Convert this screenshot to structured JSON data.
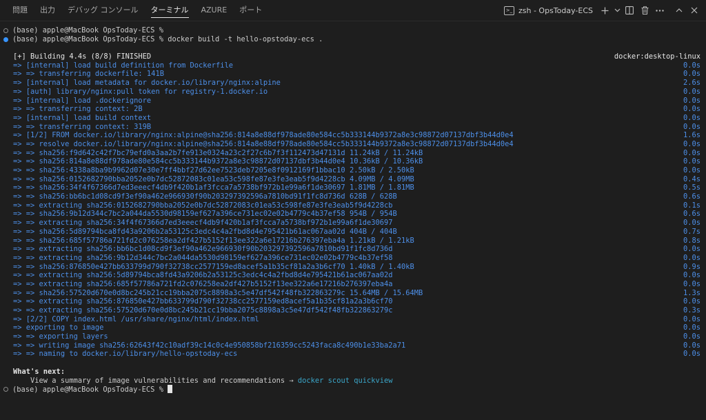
{
  "panel": {
    "tabs": [
      "問題",
      "出力",
      "デバッグ コンソール",
      "ターミナル",
      "AZURE",
      "ポート"
    ],
    "active_tab": "ターミナル",
    "terminal_label": "zsh - OpsToday-ECS"
  },
  "terminal": {
    "prompt1": "(base) apple@MacBook OpsToday-ECS %",
    "prompt2": "(base) apple@MacBook OpsToday-ECS % docker build -t hello-opstoday-ecs .",
    "build_header": "[+] Building 4.4s (8/8) FINISHED",
    "build_context": "docker:desktop-linux",
    "steps": [
      {
        "text": "=> [internal] load build definition from Dockerfile",
        "time": "0.0s"
      },
      {
        "text": "=> => transferring dockerfile: 141B",
        "time": "0.0s"
      },
      {
        "text": "=> [internal] load metadata for docker.io/library/nginx:alpine",
        "time": "2.6s"
      },
      {
        "text": "=> [auth] library/nginx:pull token for registry-1.docker.io",
        "time": "0.0s"
      },
      {
        "text": "=> [internal] load .dockerignore",
        "time": "0.0s"
      },
      {
        "text": "=> => transferring context: 2B",
        "time": "0.0s"
      },
      {
        "text": "=> [internal] load build context",
        "time": "0.0s"
      },
      {
        "text": "=> => transferring context: 319B",
        "time": "0.0s"
      },
      {
        "text": "=> [1/2] FROM docker.io/library/nginx:alpine@sha256:814a8e88df978ade80e584cc5b333144b9372a8e3c98872d07137dbf3b44d0e4",
        "time": "1.6s"
      },
      {
        "text": "=> => resolve docker.io/library/nginx:alpine@sha256:814a8e88df978ade80e584cc5b333144b9372a8e3c98872d07137dbf3b44d0e4",
        "time": "0.0s"
      },
      {
        "text": "=> => sha256:f9d642c42f7bc79efd0a3aa2b7fe913e0324a23c2f27c6b7f3f112473d47131d 11.24kB / 11.24kB",
        "time": "0.0s"
      },
      {
        "text": "=> => sha256:814a8e88df978ade80e584cc5b333144b9372a8e3c98872d07137dbf3b44d0e4 10.36kB / 10.36kB",
        "time": "0.0s"
      },
      {
        "text": "=> => sha256:4338a8ba9b9962d07e30e7ff4bbf27d62ee7523deb7205e8f0912169f1bbac10 2.50kB / 2.50kB",
        "time": "0.0s"
      },
      {
        "text": "=> => sha256:0152682790bba2052e0b7dc52872083c01ea53c598fe87e3fe3eab5f9d4228cb 4.09MB / 4.09MB",
        "time": "0.4s"
      },
      {
        "text": "=> => sha256:34f4f67366d7ed3eeecf4db9f420b1af3fcca7a5738bf972b1e99a6f1de30697 1.81MB / 1.81MB",
        "time": "0.5s"
      },
      {
        "text": "=> => sha256:bb6bc1d08cd9f3ef90a462e966930f90b203297392596a7810bd91f1fc8d736d 628B / 628B",
        "time": "0.6s"
      },
      {
        "text": "=> => extracting sha256:0152682790bba2052e0b7dc52872083c01ea53c598fe87e3fe3eab5f9d4228cb",
        "time": "0.1s"
      },
      {
        "text": "=> => sha256:9b12d344c7bc2a044da5530d98159ef627a396ce731ec02e02b4779c4b37ef58 954B / 954B",
        "time": "0.6s"
      },
      {
        "text": "=> => extracting sha256:34f4f67366d7ed3eeecf4db9f420b1af3fcca7a5738bf972b1e99a6f1de30697",
        "time": "0.0s"
      },
      {
        "text": "=> => sha256:5d89794bca8fd43a9206b2a53125c3edc4c4a2fbd8d4e795421b61ac067aa02d 404B / 404B",
        "time": "0.7s"
      },
      {
        "text": "=> => sha256:685f57786a721fd2c076258ea2df427b5152f13ee322a6e17216b276397eba4a 1.21kB / 1.21kB",
        "time": "0.8s"
      },
      {
        "text": "=> => extracting sha256:bb6bc1d08cd9f3ef90a462e966930f90b203297392596a7810bd91f1fc8d736d",
        "time": "0.0s"
      },
      {
        "text": "=> => extracting sha256:9b12d344c7bc2a044da5530d98159ef627a396ce731ec02e02b4779c4b37ef58",
        "time": "0.0s"
      },
      {
        "text": "=> => sha256:876850e427bb633799d790f32738cc2577159ed8acef5a1b35cf81a2a3b6cf70 1.40kB / 1.40kB",
        "time": "0.9s"
      },
      {
        "text": "=> => extracting sha256:5d89794bca8fd43a9206b2a53125c3edc4c4a2fbd8d4e795421b61ac067aa02d",
        "time": "0.0s"
      },
      {
        "text": "=> => extracting sha256:685f57786a721fd2c076258ea2df427b5152f13ee322a6e17216b276397eba4a",
        "time": "0.0s"
      },
      {
        "text": "=> => sha256:57520d670e0d8bc245b21cc19bba2075c8898a3c5e47df542f48fb322863279c 15.64MB / 15.64MB",
        "time": "1.3s"
      },
      {
        "text": "=> => extracting sha256:876850e427bb633799d790f32738cc2577159ed8acef5a1b35cf81a2a3b6cf70",
        "time": "0.0s"
      },
      {
        "text": "=> => extracting sha256:57520d670e0d8bc245b21cc19bba2075c8898a3c5e47df542f48fb322863279c",
        "time": "0.3s"
      },
      {
        "text": "=> [2/2] COPY index.html /usr/share/nginx/html/index.html",
        "time": "0.0s"
      },
      {
        "text": "=> exporting to image",
        "time": "0.0s"
      },
      {
        "text": "=> => exporting layers",
        "time": "0.0s"
      },
      {
        "text": "=> => writing image sha256:62643f42c10adf39c14c0c4e950858bf216359cc5243faca8c490b1e33ba2a71",
        "time": "0.0s"
      },
      {
        "text": "=> => naming to docker.io/library/hello-opstoday-ecs",
        "time": "0.0s"
      }
    ],
    "whats_next": "What's next:",
    "summary_text": "    View a summary of image vulnerabilities and recommendations → ",
    "summary_cmd": "docker scout quickview",
    "prompt3": "(base) apple@MacBook OpsToday-ECS % "
  }
}
